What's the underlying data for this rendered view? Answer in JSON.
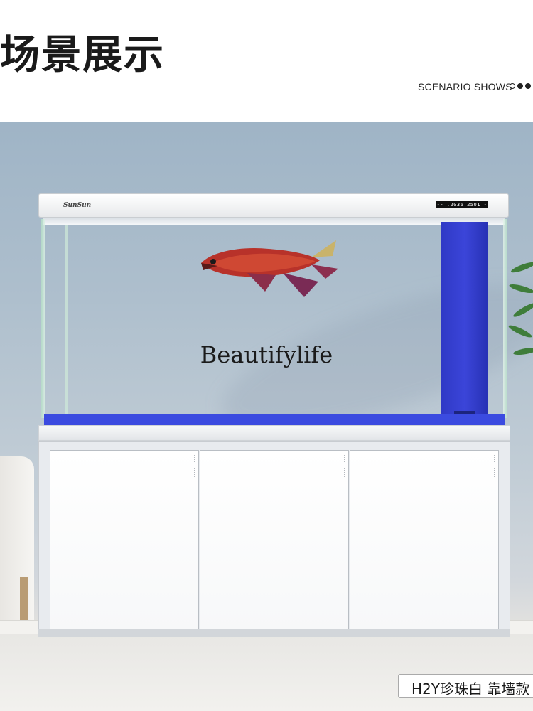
{
  "header": {
    "title": "场景展示",
    "subtitle": "SCENARIO SHOWS",
    "dots": [
      "outline",
      "filled",
      "filled"
    ]
  },
  "product": {
    "brand": "SunSun",
    "display_text": "-- .2036 2501 -",
    "watermark": "Beautifylife",
    "caption": "H2Y珍珠白 靠墙款"
  },
  "colors": {
    "filter_blue": "#3b45d9",
    "cabinet_white": "#ffffff",
    "wall": "#aebfcd"
  }
}
